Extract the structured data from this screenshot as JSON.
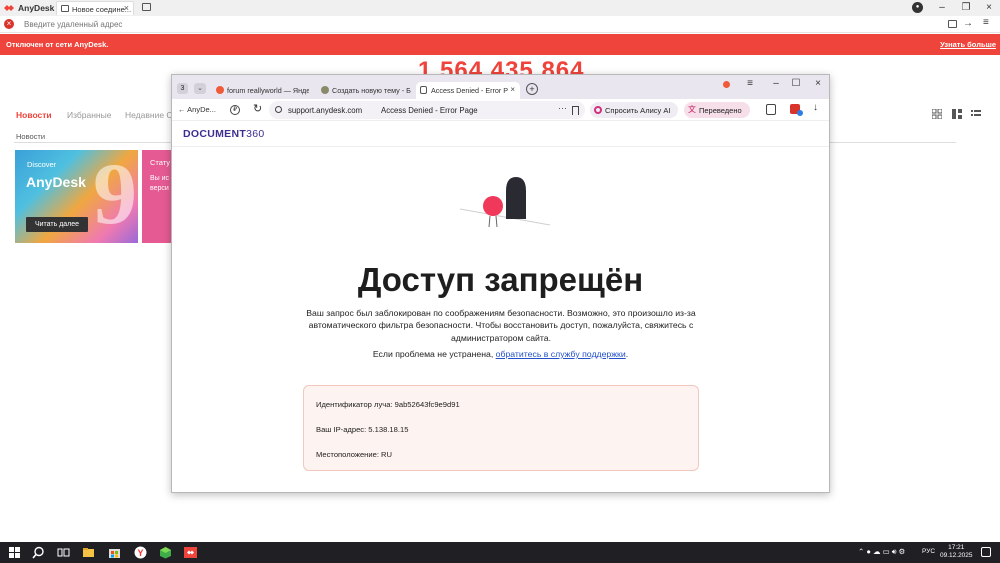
{
  "anydesk": {
    "app_title": "AnyDesk",
    "tab_label": "Новое соедине...",
    "address_placeholder": "Введите удаленный адрес",
    "banner_text": "Отключен от сети AnyDesk.",
    "banner_link": "Узнать больше",
    "id_partial": "1 564 435 864",
    "nav_items": [
      "Новости",
      "Избранные",
      "Недавние С"
    ],
    "section_label": "Новости",
    "card1": {
      "small": "Discover",
      "title": "AnyDesk",
      "big_digit": "9",
      "button": "Читать далее"
    },
    "card2": {
      "title": "Стату",
      "line1": "Вы ис",
      "line2": "верси"
    },
    "accent_color": "#ef443b"
  },
  "browser": {
    "tab_count": "3",
    "tabs": [
      {
        "label": "forum reallyworld — Янде"
      },
      {
        "label": "Создать новую тему - Б"
      },
      {
        "label": "Access Denied - Error P"
      }
    ],
    "back_label": "AnyDe...",
    "url": "support.anydesk.com",
    "page_title": "Access Denied - Error Page",
    "alice_label": "Спросить Алису AI",
    "translated_label": "Переведено"
  },
  "page": {
    "logo_text": "DOCUMENT",
    "logo_num": "360",
    "heading": "Доступ запрещён",
    "description": "Ваш запрос был заблокирован по соображениям безопасности. Возможно, это произошло из-за автоматического фильтра безопасности. Чтобы восстановить доступ, пожалуйста, свяжитесь с администратором сайта.",
    "help_prefix": "Если проблема не устранена, ",
    "help_link": "обратитесь в службу поддержки",
    "help_suffix": ".",
    "ray_id": "Идентификатор луча: 9ab52643fc9e9d91",
    "ip": "Ваш IP-адрес: 5.138.18.15",
    "location": "Местоположение: RU"
  },
  "taskbar": {
    "lang": "РУС",
    "time": "17:21",
    "date": "09.12.2025"
  }
}
